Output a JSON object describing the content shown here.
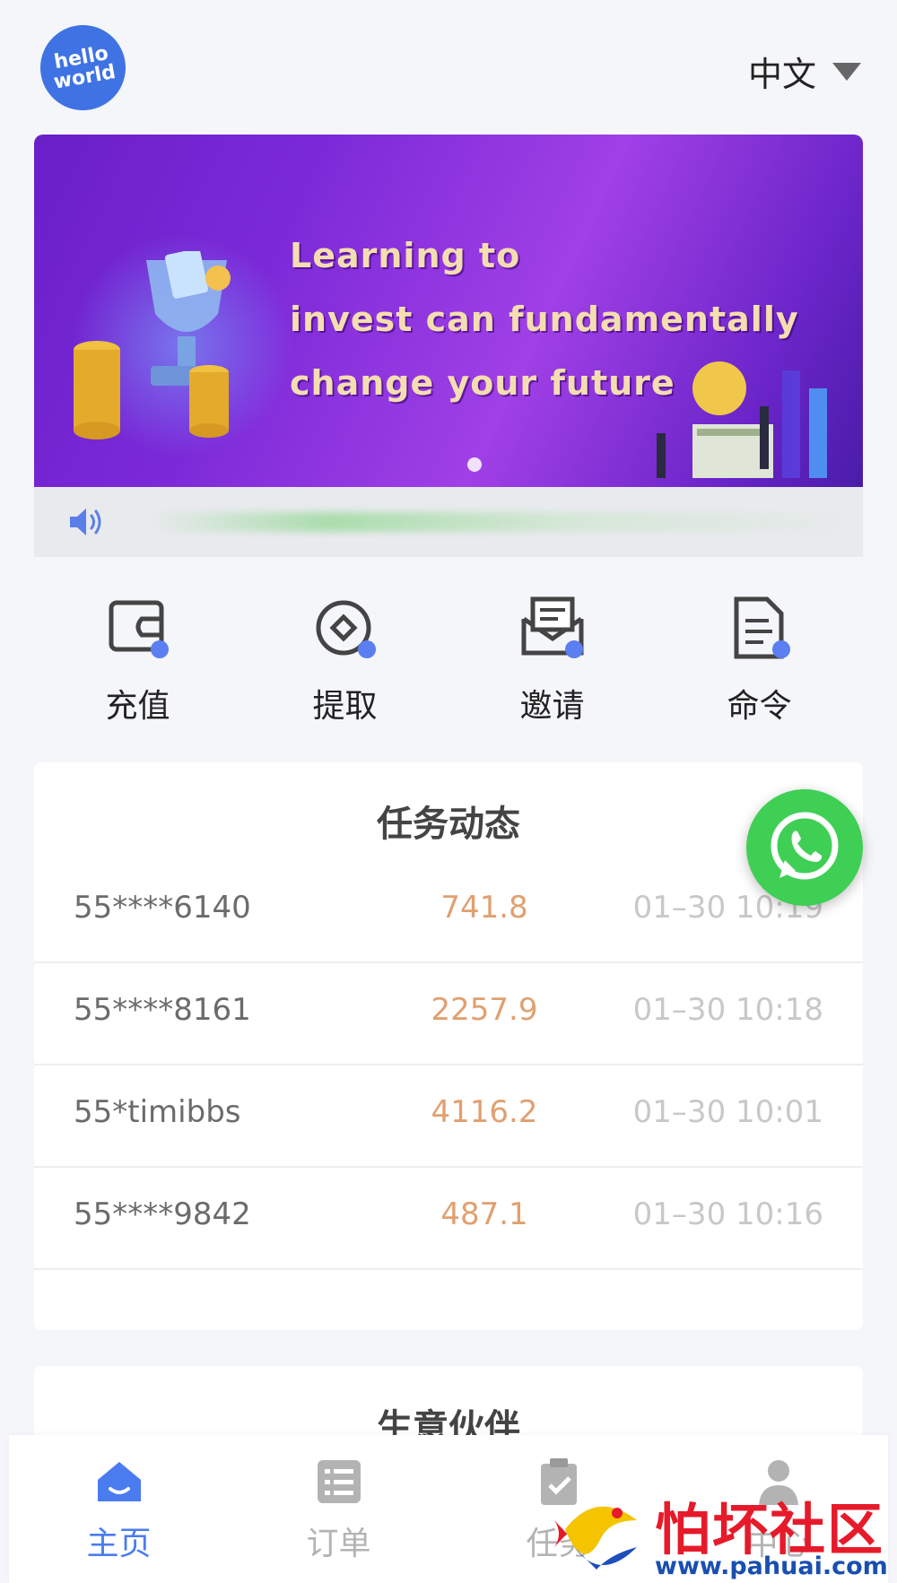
{
  "header": {
    "logo_line1": "hello",
    "logo_line2": "world",
    "language": "中文"
  },
  "banner": {
    "lines": [
      "Learning to",
      "invest can fundamentally",
      "change your future"
    ],
    "slide_count": 1,
    "active_slide": 1
  },
  "notice": {
    "text": ""
  },
  "actions": [
    {
      "label": "充值",
      "icon": "wallet-icon"
    },
    {
      "label": "提取",
      "icon": "coin-icon"
    },
    {
      "label": "邀请",
      "icon": "envelope-icon"
    },
    {
      "label": "命令",
      "icon": "document-icon"
    }
  ],
  "feed": {
    "title": "任务动态",
    "rows": [
      {
        "user": "55****6140",
        "amount": "741.8",
        "time": "01–30 10:19"
      },
      {
        "user": "55****8161",
        "amount": "2257.9",
        "time": "01–30 10:18"
      },
      {
        "user": "55*timibbs",
        "amount": "4116.2",
        "time": "01–30 10:01"
      },
      {
        "user": "55****9842",
        "amount": "487.1",
        "time": "01–30 10:16"
      }
    ]
  },
  "partner": {
    "title": "生意伙伴"
  },
  "nav": {
    "items": [
      {
        "label": "主页",
        "icon": "home-icon",
        "active": true
      },
      {
        "label": "订单",
        "icon": "list-icon",
        "active": false
      },
      {
        "label": "任务",
        "icon": "clipboard-icon",
        "active": false
      },
      {
        "label": "中心",
        "icon": "user-icon",
        "active": false
      }
    ]
  },
  "watermark": {
    "title": "怕坏社区",
    "url": "www.pahuai.com"
  },
  "colors": {
    "accent": "#4a7cf0",
    "amount": "#e0a070",
    "whatsapp": "#3fcf55",
    "banner": "#7c2ad8"
  }
}
